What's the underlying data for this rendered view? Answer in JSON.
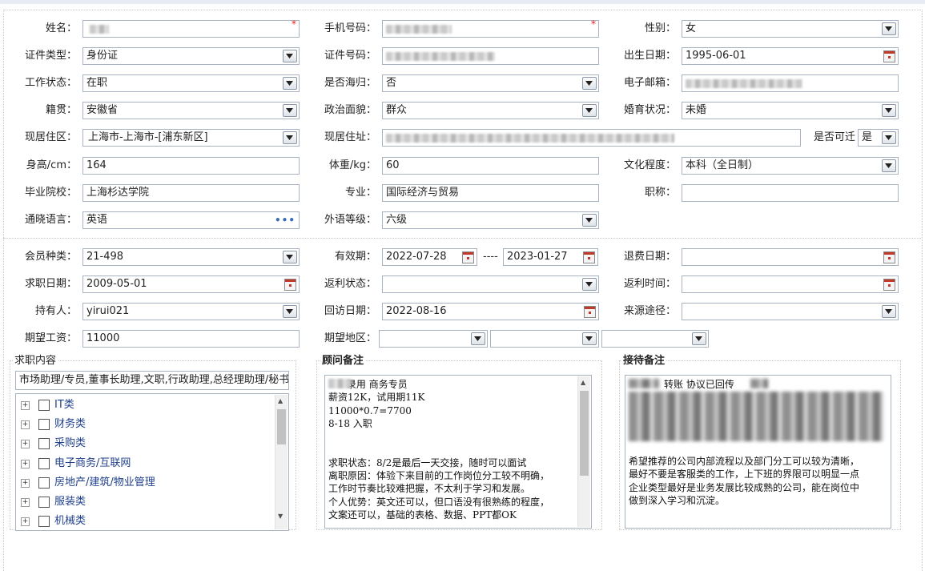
{
  "form": {
    "name": {
      "label": "姓名：",
      "required": "*"
    },
    "phone": {
      "label": "手机号码：",
      "required": "*"
    },
    "gender": {
      "label": "性别：",
      "value": "女"
    },
    "id_type": {
      "label": "证件类型：",
      "value": "身份证"
    },
    "id_number": {
      "label": "证件号码："
    },
    "birth_date": {
      "label": "出生日期：",
      "value": "1995-06-01"
    },
    "work_status": {
      "label": "工作状态：",
      "value": "在职"
    },
    "returnee": {
      "label": "是否海归：",
      "value": "否"
    },
    "email": {
      "label": "电子邮箱："
    },
    "native_place": {
      "label": "籍贯：",
      "value": "安徽省"
    },
    "political": {
      "label": "政治面貌：",
      "value": "群众"
    },
    "marital": {
      "label": "婚育状况：",
      "value": "未婚"
    },
    "residence_area": {
      "label": "现居住区：",
      "value": "上海市-上海市-[浦东新区]"
    },
    "address": {
      "label": "现居住址："
    },
    "relocate": {
      "label": "是否可迁",
      "value": "是"
    },
    "height": {
      "label": "身高/cm：",
      "value": "164"
    },
    "weight": {
      "label": "体重/kg：",
      "value": "60"
    },
    "education": {
      "label": "文化程度：",
      "value": "本科（全日制）"
    },
    "school": {
      "label": "毕业院校：",
      "value": "上海杉达学院"
    },
    "major": {
      "label": "专业：",
      "value": "国际经济与贸易"
    },
    "title": {
      "label": "职称：",
      "value": ""
    },
    "language": {
      "label": "通晓语言：",
      "value": "英语",
      "more": "•••"
    },
    "lang_level": {
      "label": "外语等级：",
      "value": "六级"
    }
  },
  "membership": {
    "member_type": {
      "label": "会员种类：",
      "value": "21-498"
    },
    "validity": {
      "label": "有效期：",
      "start": "2022-07-28",
      "sep": "----",
      "end": "2023-01-27"
    },
    "refund_date": {
      "label": "退费日期：",
      "value": ""
    },
    "job_date": {
      "label": "求职日期：",
      "value": "2009-05-01"
    },
    "rebate_status": {
      "label": "返利状态：",
      "value": ""
    },
    "rebate_time": {
      "label": "返利时间：",
      "value": ""
    },
    "holder": {
      "label": "持有人：",
      "value": "yirui021"
    },
    "revisit_date": {
      "label": "回访日期：",
      "value": "2022-08-16"
    },
    "source": {
      "label": "来源途径：",
      "value": ""
    },
    "salary": {
      "label": "期望工资：",
      "value": "11000"
    },
    "region": {
      "label": "期望地区："
    }
  },
  "job_content": {
    "title": "求职内容",
    "summary": "市场助理/专员,董事长助理,文职,行政助理,总经理助理/秘书",
    "categories": [
      "IT类",
      "财务类",
      "采购类",
      "电子商务/互联网",
      "房地产/建筑/物业管理",
      "服装类",
      "机械类"
    ]
  },
  "advisor_notes": {
    "title": "顾问备注",
    "text": "      录用 商务专员\n薪资12K，试用期11K\n11000*0.7=7700\n8-18 入职\n\n\n求职状态：8/2是最后一天交接，随时可以面试\n离职原因：体验下来目前的工作岗位分工较不明确，\n工作时节奏比较难把握，不太利于学习和发展。\n个人优势：英文还可以，但口语没有很熟练的程度，\n文案还可以，基础的表格、数据、PPT都OK"
  },
  "reception_notes": {
    "title": "接待备注",
    "first_line": "转账 协议已回传",
    "text": "希望推荐的公司内部流程以及部门分工可以较为清晰，\n最好不要是客服类的工作，上下班的界限可以明显一点\n企业类型最好是业务发展比较成熟的公司，能在岗位中\n做到深入学习和沉淀。"
  },
  "icons": {
    "dropdown": "chevron-down-icon",
    "calendar": "calendar-icon",
    "more": "ellipsis-icon"
  }
}
